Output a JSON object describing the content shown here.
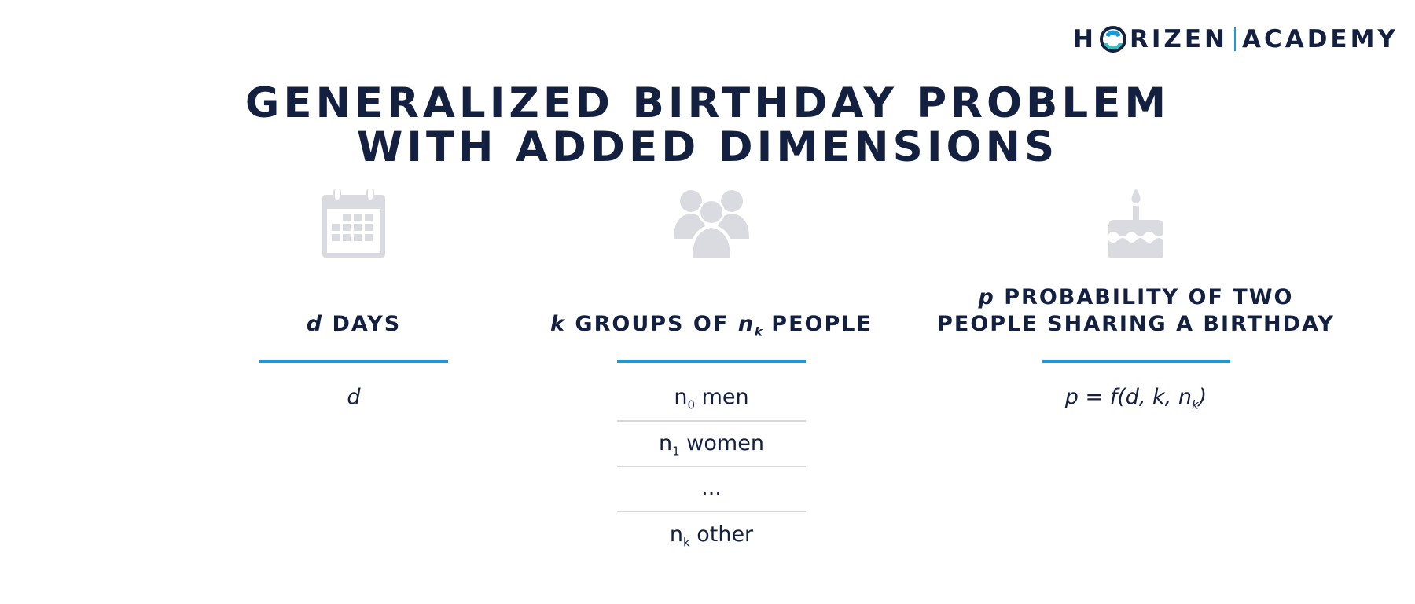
{
  "logo": {
    "left_text": "H",
    "right_text": "RIZEN",
    "academy": "ACADEMY"
  },
  "title": {
    "line1": "GENERALIZED BIRTHDAY PROBLEM",
    "line2": "WITH ADDED DIMENSIONS"
  },
  "columns": [
    {
      "icon": "calendar-icon",
      "heading": {
        "var": "d",
        "text": " DAYS"
      },
      "value": "d"
    },
    {
      "icon": "people-group-icon",
      "heading": {
        "var": "k",
        "mid": " GROUPS OF ",
        "var2": "n",
        "sub": "k",
        "text": " PEOPLE"
      },
      "rows": [
        {
          "base": "n",
          "sub": "0",
          "text": " men"
        },
        {
          "base": "n",
          "sub": "1",
          "text": " women"
        },
        {
          "base": "",
          "sub": "",
          "text": "..."
        },
        {
          "base": "n",
          "sub": "k",
          "text": " other"
        }
      ]
    },
    {
      "icon": "birthday-cake-icon",
      "heading": {
        "var": "p",
        "line1": " PROBABILITY OF TWO",
        "line2": "PEOPLE SHARING A BIRTHDAY"
      },
      "formula_main": "p = f(d, k, n",
      "formula_sub": "k",
      "formula_end": ")"
    }
  ],
  "colors": {
    "navy": "#13203f",
    "accent": "#1f96d6",
    "icon_gray": "#dadbe0",
    "logo_teal": "#2ec4c6"
  }
}
